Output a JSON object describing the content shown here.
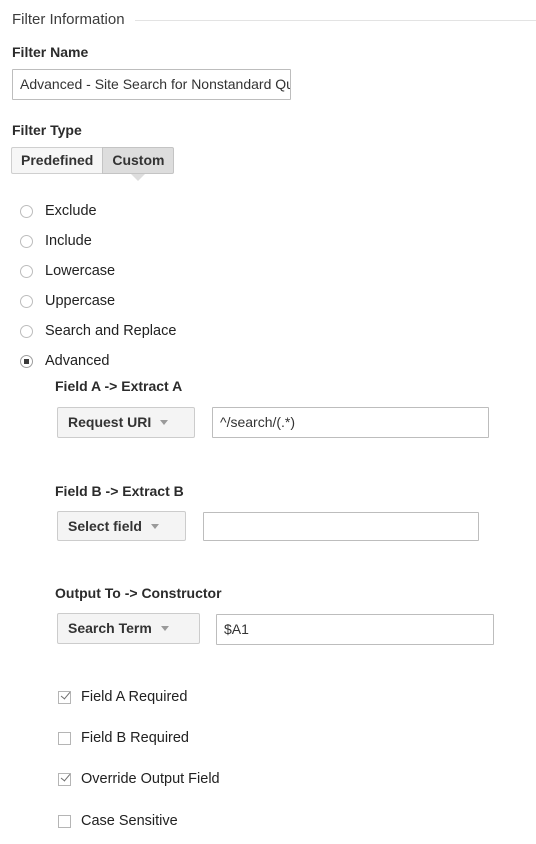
{
  "section": {
    "title": "Filter Information"
  },
  "filter_name": {
    "label": "Filter Name",
    "value": "Advanced - Site Search for Nonstandard Query Parameters",
    "placeholder": ""
  },
  "filter_type": {
    "label": "Filter Type",
    "tabs": [
      {
        "label": "Predefined",
        "active": false
      },
      {
        "label": "Custom",
        "active": true
      }
    ],
    "selected_tab": "Custom"
  },
  "filter_options": {
    "selected": "Advanced",
    "items": [
      {
        "label": "Exclude",
        "checked": false
      },
      {
        "label": "Include",
        "checked": false
      },
      {
        "label": "Lowercase",
        "checked": false
      },
      {
        "label": "Uppercase",
        "checked": false
      },
      {
        "label": "Search and Replace",
        "checked": false
      },
      {
        "label": "Advanced",
        "checked": true
      }
    ]
  },
  "advanced": {
    "field_a": {
      "label": "Field A -> Extract A",
      "select_value": "Select field",
      "select_display": "Request URI",
      "input_value": "^/search/(.*)",
      "input_placeholder": ""
    },
    "field_b": {
      "label": "Field B -> Extract B",
      "select_display": "Select field",
      "input_value": "",
      "input_placeholder": ""
    },
    "output": {
      "label": "Output To -> Constructor",
      "select_display": "Search Term",
      "input_value": "$A1",
      "input_placeholder": ""
    },
    "checkboxes": [
      {
        "label": "Field A Required",
        "checked": true
      },
      {
        "label": "Field B Required",
        "checked": false
      },
      {
        "label": "Override Output Field",
        "checked": true
      },
      {
        "label": "Case Sensitive",
        "checked": false
      }
    ]
  },
  "colors": {
    "text": "#212121",
    "rule": "#e3e3e3",
    "input_border": "#bdbdbd",
    "tab_active_bg": "#dddddd",
    "tab_inactive_bg": "#f6f6f6",
    "select_bg": "#f4f4f4"
  },
  "icons": {
    "dropdown_arrow": "chevron-down-icon",
    "tab_caret": "caret-down-icon"
  }
}
